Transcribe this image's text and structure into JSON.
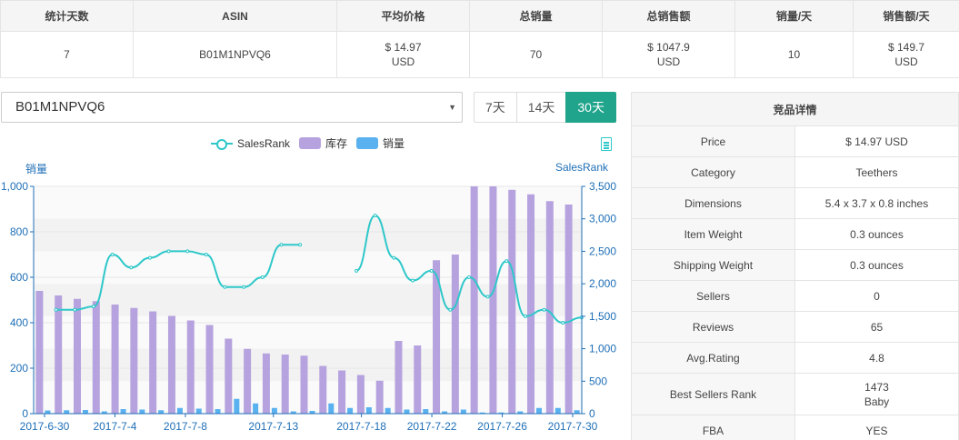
{
  "summary": {
    "headers": [
      "统计天数",
      "ASIN",
      "平均价格",
      "总销量",
      "总销售额",
      "销量/天",
      "销售额/天"
    ],
    "row": [
      [
        "7"
      ],
      [
        "B01M1NPVQ6"
      ],
      [
        "$ 14.97",
        "USD"
      ],
      [
        "70"
      ],
      [
        "$ 1047.9",
        "USD"
      ],
      [
        "10"
      ],
      [
        "$ 149.7",
        "USD"
      ]
    ]
  },
  "selector": {
    "asin": "B01M1NPVQ6",
    "ranges": [
      "7天",
      "14天",
      "30天"
    ],
    "active_range": "30天"
  },
  "chart_data": {
    "type": "bar",
    "legend": [
      "SalesRank",
      "库存",
      "销量"
    ],
    "legend_placement": "top",
    "y_left": {
      "name": "销量",
      "min": 0,
      "max": 1000,
      "ticks": [
        "0",
        "200",
        "400",
        "600",
        "800",
        "1,000"
      ]
    },
    "y_right": {
      "name": "SalesRank",
      "min": 0,
      "max": 3500,
      "ticks": [
        "0",
        "500",
        "1,000",
        "1,500",
        "2,000",
        "2,500",
        "3,000",
        "3,500"
      ]
    },
    "x_tick_labels": [
      "2017-6-30",
      "2017-7-4",
      "2017-7-8",
      "2017-7-13",
      "2017-7-18",
      "2017-7-22",
      "2017-7-26",
      "2017-7-30"
    ],
    "x_label_days": [
      0,
      4,
      8,
      13,
      18,
      22,
      26,
      30
    ],
    "days": 31,
    "series": [
      {
        "name": "库存",
        "type": "bar",
        "color": "#b6a2de",
        "values": [
          540,
          520,
          505,
          495,
          480,
          465,
          450,
          430,
          410,
          390,
          330,
          285,
          265,
          260,
          255,
          210,
          190,
          170,
          145,
          320,
          300,
          675,
          700,
          1000,
          1000,
          985,
          965,
          935,
          920
        ]
      },
      {
        "name": "销量",
        "type": "bar",
        "color": "#5ab1ef",
        "values": [
          14,
          15,
          16,
          10,
          20,
          18,
          15,
          25,
          22,
          20,
          65,
          45,
          25,
          10,
          12,
          45,
          25,
          28,
          25,
          18,
          20,
          10,
          18,
          5,
          5,
          10,
          25,
          25,
          15
        ]
      },
      {
        "name": "SalesRank",
        "type": "line",
        "color": "#2ec7c9",
        "segments": [
          [
            [
              1,
              1600
            ],
            [
              2,
              1600
            ],
            [
              3,
              1650
            ],
            [
              4,
              2450
            ],
            [
              5,
              2250
            ],
            [
              6,
              2400
            ],
            [
              7,
              2500
            ],
            [
              8,
              2500
            ],
            [
              9,
              2450
            ],
            [
              10,
              1950
            ],
            [
              11,
              1950
            ],
            [
              12,
              2100
            ],
            [
              13,
              2600
            ],
            [
              14,
              2600
            ]
          ],
          [
            [
              17,
              2200
            ],
            [
              18,
              3050
            ],
            [
              19,
              2400
            ],
            [
              20,
              2050
            ],
            [
              21,
              2200
            ],
            [
              22,
              1600
            ],
            [
              23,
              2100
            ],
            [
              24,
              1800
            ],
            [
              25,
              2350
            ],
            [
              26,
              1500
            ],
            [
              27,
              1600
            ],
            [
              28,
              1400
            ],
            [
              29,
              1480
            ]
          ]
        ]
      }
    ]
  },
  "detail": {
    "title": "竞品详情",
    "rows": [
      {
        "key": "Price",
        "value": [
          "$ 14.97 USD"
        ]
      },
      {
        "key": "Category",
        "value": [
          "Teethers"
        ]
      },
      {
        "key": "Dimensions",
        "value": [
          "5.4 x 3.7 x 0.8 inches"
        ]
      },
      {
        "key": "Item Weight",
        "value": [
          "0.3 ounces"
        ]
      },
      {
        "key": "Shipping Weight",
        "value": [
          "0.3 ounces"
        ]
      },
      {
        "key": "Sellers",
        "value": [
          "0"
        ]
      },
      {
        "key": "Reviews",
        "value": [
          "65"
        ]
      },
      {
        "key": "Avg.Rating",
        "value": [
          "4.8"
        ]
      },
      {
        "key": "Best Sellers Rank",
        "value": [
          "1473",
          "Baby"
        ]
      },
      {
        "key": "FBA",
        "value": [
          "YES"
        ]
      }
    ]
  }
}
